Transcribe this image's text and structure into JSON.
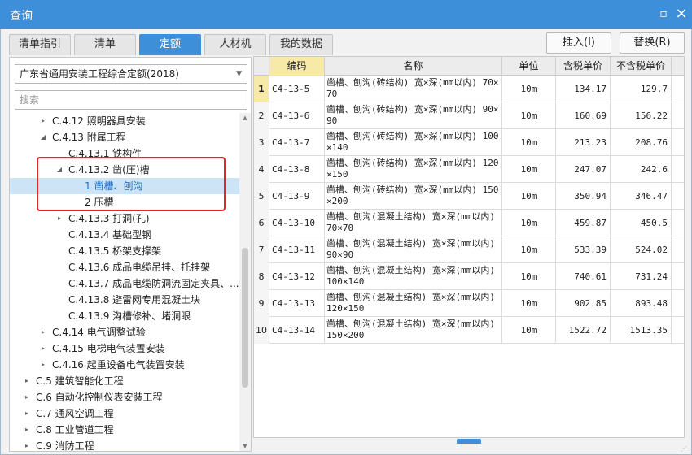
{
  "window": {
    "title": "查询",
    "minimize_glyph": "▫",
    "close_glyph": "×"
  },
  "tabs": [
    {
      "label": "清单指引"
    },
    {
      "label": "清单"
    },
    {
      "label": "定额"
    },
    {
      "label": "人材机"
    },
    {
      "label": "我的数据"
    }
  ],
  "actions": {
    "insert_label": "插入(I)",
    "replace_label": "替换(R)"
  },
  "left": {
    "library_select": "广东省通用安装工程综合定额(2018)",
    "search_placeholder": "搜索"
  },
  "tree": [
    {
      "toggle": "▸",
      "label": "C.4.12 照明器具安装",
      "selected": false
    },
    {
      "toggle": "◢",
      "label": "C.4.13 附属工程",
      "selected": false
    },
    {
      "toggle": "",
      "label": "C.4.13.1 铁构件",
      "selected": false
    },
    {
      "toggle": "◢",
      "label": "C.4.13.2 凿(压)槽",
      "selected": false
    },
    {
      "toggle": "",
      "label": "1 凿槽、刨沟",
      "selected": true
    },
    {
      "toggle": "",
      "label": "2 压槽",
      "selected": false
    },
    {
      "toggle": "▸",
      "label": "C.4.13.3 打洞(孔)",
      "selected": false
    },
    {
      "toggle": "",
      "label": "C.4.13.4 基础型钢",
      "selected": false
    },
    {
      "toggle": "",
      "label": "C.4.13.5 桥架支撑架",
      "selected": false
    },
    {
      "toggle": "",
      "label": "C.4.13.6 成品电缆吊挂、托挂架",
      "selected": false
    },
    {
      "toggle": "",
      "label": "C.4.13.7 成品电缆防洞流固定夹具、...",
      "selected": false
    },
    {
      "toggle": "",
      "label": "C.4.13.8 避雷网专用混凝土块",
      "selected": false
    },
    {
      "toggle": "",
      "label": "C.4.13.9 沟槽修补、堵洞眼",
      "selected": false
    },
    {
      "toggle": "▸",
      "label": "C.4.14 电气调整试验",
      "selected": false
    },
    {
      "toggle": "▸",
      "label": "C.4.15 电梯电气装置安装",
      "selected": false
    },
    {
      "toggle": "▸",
      "label": "C.4.16 起重设备电气装置安装",
      "selected": false
    },
    {
      "toggle": "▸",
      "label": "C.5 建筑智能化工程",
      "selected": false
    },
    {
      "toggle": "▸",
      "label": "C.6 自动化控制仪表安装工程",
      "selected": false
    },
    {
      "toggle": "▸",
      "label": "C.7 通风空调工程",
      "selected": false
    },
    {
      "toggle": "▸",
      "label": "C.8 工业管道工程",
      "selected": false
    },
    {
      "toggle": "▸",
      "label": "C.9 消防工程",
      "selected": false
    }
  ],
  "grid": {
    "headers": [
      "",
      "编码",
      "名称",
      "单位",
      "含税单价",
      "不含税单价"
    ],
    "rows": [
      {
        "idx": "1",
        "code": "C4-13-5",
        "name": "凿槽、刨沟(砖结构) 宽×深(mm以内) 70×70",
        "unit": "10m",
        "price_tax": "134.17",
        "price_notax": "129.7"
      },
      {
        "idx": "2",
        "code": "C4-13-6",
        "name": "凿槽、刨沟(砖结构) 宽×深(mm以内) 90×90",
        "unit": "10m",
        "price_tax": "160.69",
        "price_notax": "156.22"
      },
      {
        "idx": "3",
        "code": "C4-13-7",
        "name": "凿槽、刨沟(砖结构) 宽×深(mm以内) 100×140",
        "unit": "10m",
        "price_tax": "213.23",
        "price_notax": "208.76"
      },
      {
        "idx": "4",
        "code": "C4-13-8",
        "name": "凿槽、刨沟(砖结构) 宽×深(mm以内) 120×150",
        "unit": "10m",
        "price_tax": "247.07",
        "price_notax": "242.6"
      },
      {
        "idx": "5",
        "code": "C4-13-9",
        "name": "凿槽、刨沟(砖结构) 宽×深(mm以内) 150×200",
        "unit": "10m",
        "price_tax": "350.94",
        "price_notax": "346.47"
      },
      {
        "idx": "6",
        "code": "C4-13-10",
        "name": "凿槽、刨沟(混凝土结构) 宽×深(mm以内) 70×70",
        "unit": "10m",
        "price_tax": "459.87",
        "price_notax": "450.5"
      },
      {
        "idx": "7",
        "code": "C4-13-11",
        "name": "凿槽、刨沟(混凝土结构) 宽×深(mm以内) 90×90",
        "unit": "10m",
        "price_tax": "533.39",
        "price_notax": "524.02"
      },
      {
        "idx": "8",
        "code": "C4-13-12",
        "name": "凿槽、刨沟(混凝土结构) 宽×深(mm以内) 100×140",
        "unit": "10m",
        "price_tax": "740.61",
        "price_notax": "731.24"
      },
      {
        "idx": "9",
        "code": "C4-13-13",
        "name": "凿槽、刨沟(混凝土结构) 宽×深(mm以内) 120×150",
        "unit": "10m",
        "price_tax": "902.85",
        "price_notax": "893.48"
      },
      {
        "idx": "10",
        "code": "C4-13-14",
        "name": "凿槽、刨沟(混凝土结构) 宽×深(mm以内) 150×200",
        "unit": "10m",
        "price_tax": "1522.72",
        "price_notax": "1513.35"
      }
    ]
  },
  "colors": {
    "accent": "#3d8fd9",
    "highlight": "#e02626",
    "code_header": "#f7e9a8"
  }
}
